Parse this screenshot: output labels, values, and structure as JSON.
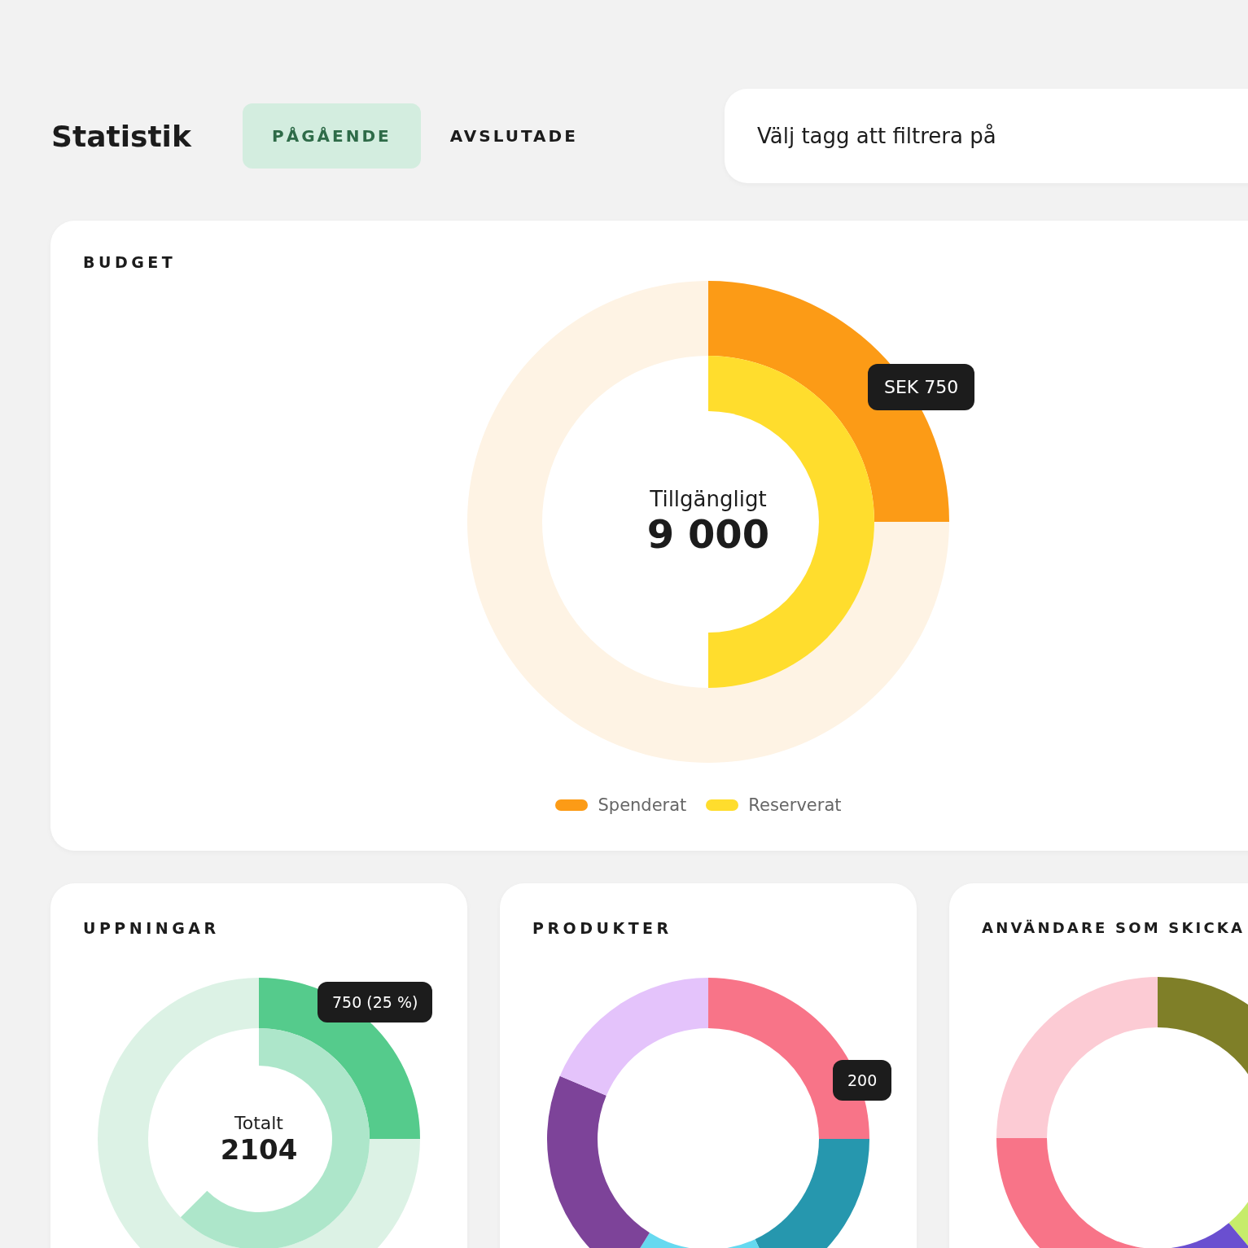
{
  "title": "Statistik",
  "tabs": [
    {
      "label": "PÅGÅENDE",
      "selected": true
    },
    {
      "label": "AVSLUTADE",
      "selected": false
    }
  ],
  "filter": {
    "placeholder": "Välj tagg att filtrera på"
  },
  "budget": {
    "title": "BUDGET",
    "center_label": "Tillgängligt",
    "center_value": "9 000",
    "tooltip": "SEK 750",
    "legend": [
      {
        "label": "Spenderat",
        "color": "#fc9b16"
      },
      {
        "label": "Reserverat",
        "color": "#ffdd2d"
      }
    ]
  },
  "cards": [
    {
      "title": "UPPNINGAR",
      "center_label": "Totalt",
      "center_value": "2104",
      "tooltip": "750 (25 %)"
    },
    {
      "title": "PRODUKTER",
      "tooltip": "200"
    },
    {
      "title": "ANVÄNDARE SOM SKICKA"
    }
  ]
}
